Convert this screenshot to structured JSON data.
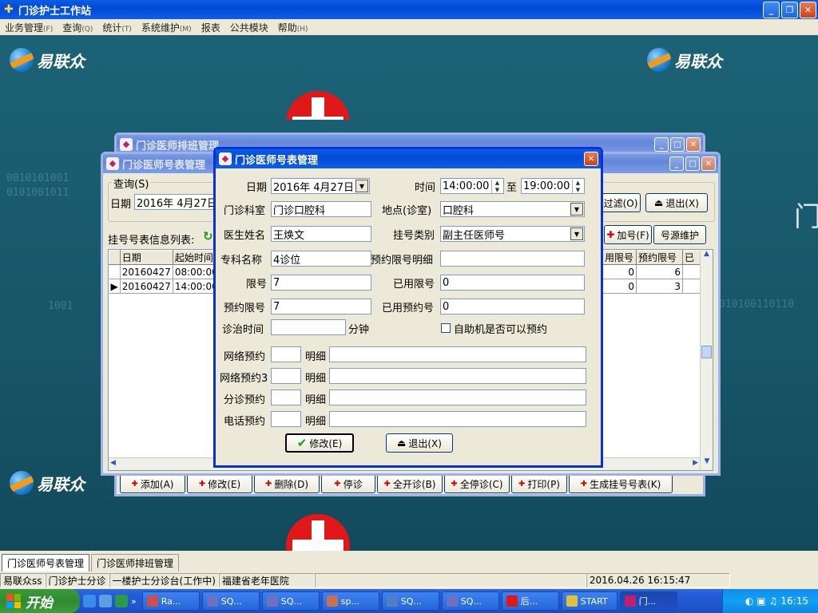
{
  "app": {
    "title": "门诊护士工作站",
    "menu": [
      {
        "label": "业务管理",
        "key": "(F)"
      },
      {
        "label": "查询",
        "key": "(Q)"
      },
      {
        "label": "统计",
        "key": "(T)"
      },
      {
        "label": "系统维护",
        "key": "(M)"
      },
      {
        "label": "报表",
        "key": ""
      },
      {
        "label": "公共模块",
        "key": ""
      },
      {
        "label": "帮助",
        "key": "(H)"
      }
    ],
    "logo_text": "易联众",
    "bg_binary_1": "0010101001",
    "bg_binary_2": "0101001011",
    "bg_binary_3": "1001",
    "bg_binary_4": "010100110110",
    "bg_char": "门"
  },
  "schedule_window": {
    "title": "门诊医师排班管理",
    "toolbar": [
      "添加(A)",
      "修改(E)",
      "删除(D)",
      "停诊",
      "全开诊(B)",
      "全停诊(C)",
      "打印(P)",
      "生成挂号号表(K)"
    ]
  },
  "number_table_window": {
    "title": "门诊医师号表管理",
    "query_group": "查询(S)",
    "date_label": "日期",
    "date_value": "2016年 4月27日",
    "filter_button": "过滤(O)",
    "exit_button": "退出(X)",
    "list_label": "挂号号表信息列表:",
    "add_button": "加号(F)",
    "source_button": "号源维护",
    "columns": [
      "日期",
      "起始时间"
    ],
    "rows": [
      {
        "date": "20160427",
        "start": "08:00:00",
        "used": "0",
        "reserved": "6"
      },
      {
        "date": "20160427",
        "start": "14:00:00",
        "used": "0",
        "reserved": "3"
      }
    ],
    "right_columns": [
      "用限号",
      "预约限号",
      "已"
    ]
  },
  "dialog": {
    "title": "门诊医师号表管理",
    "date_label": "日期",
    "date_value": "2016年 4月27日",
    "time_label": "时间",
    "time_start": "14:00:00",
    "time_to": "至",
    "time_end": "19:00:00",
    "dept_label": "门诊科室",
    "dept_value": "门诊口腔科",
    "location_label": "地点(诊室)",
    "location_value": "口腔科",
    "doctor_label": "医生姓名",
    "doctor_value": "王焕文",
    "reg_type_label": "挂号类别",
    "reg_type_value": "副主任医师号",
    "specialty_label": "专科名称",
    "specialty_value": "4诊位",
    "reserve_detail_label": "预约限号明细",
    "reserve_detail_value": "",
    "limit_label": "限号",
    "limit_value": "7",
    "used_limit_label": "已用限号",
    "used_limit_value": "0",
    "reserve_limit_label": "预约限号",
    "reserve_limit_value": "7",
    "used_reserve_label": "已用预约号",
    "used_reserve_value": "0",
    "consult_time_label": "诊治时间",
    "consult_time_value": "",
    "minutes_label": "分钟",
    "self_service_label": "自助机是否可以预约",
    "reservations": [
      {
        "label": "网络预约",
        "detail_label": "明细"
      },
      {
        "label": "网络预约3",
        "detail_label": "明细"
      },
      {
        "label": "分诊预约",
        "detail_label": "明细"
      },
      {
        "label": "电话预约",
        "detail_label": "明细"
      }
    ],
    "modify_button": "修改(E)",
    "exit_button": "退出(X)"
  },
  "bottom_tabs": [
    "门诊医师号表管理",
    "门诊医师排班管理"
  ],
  "status": {
    "user": "易联众ss",
    "module": "门诊护士分诊",
    "station": "一楼护士分诊台(工作中)",
    "hospital": "福建省老年医院",
    "datetime": "2016.04.26 16:15:47"
  },
  "taskbar": {
    "start": "开始",
    "items": [
      "Ra...",
      "SQ...",
      "SQ...",
      "sp...",
      "SQ...",
      "SQ...",
      "后...",
      "START",
      "门..."
    ],
    "clock": "16:15"
  },
  "colors": {
    "title_blue": "#0a5ee6",
    "desktop": "#1a5a6e",
    "start_green": "#3c9a3c",
    "red_cross": "#e01818"
  }
}
